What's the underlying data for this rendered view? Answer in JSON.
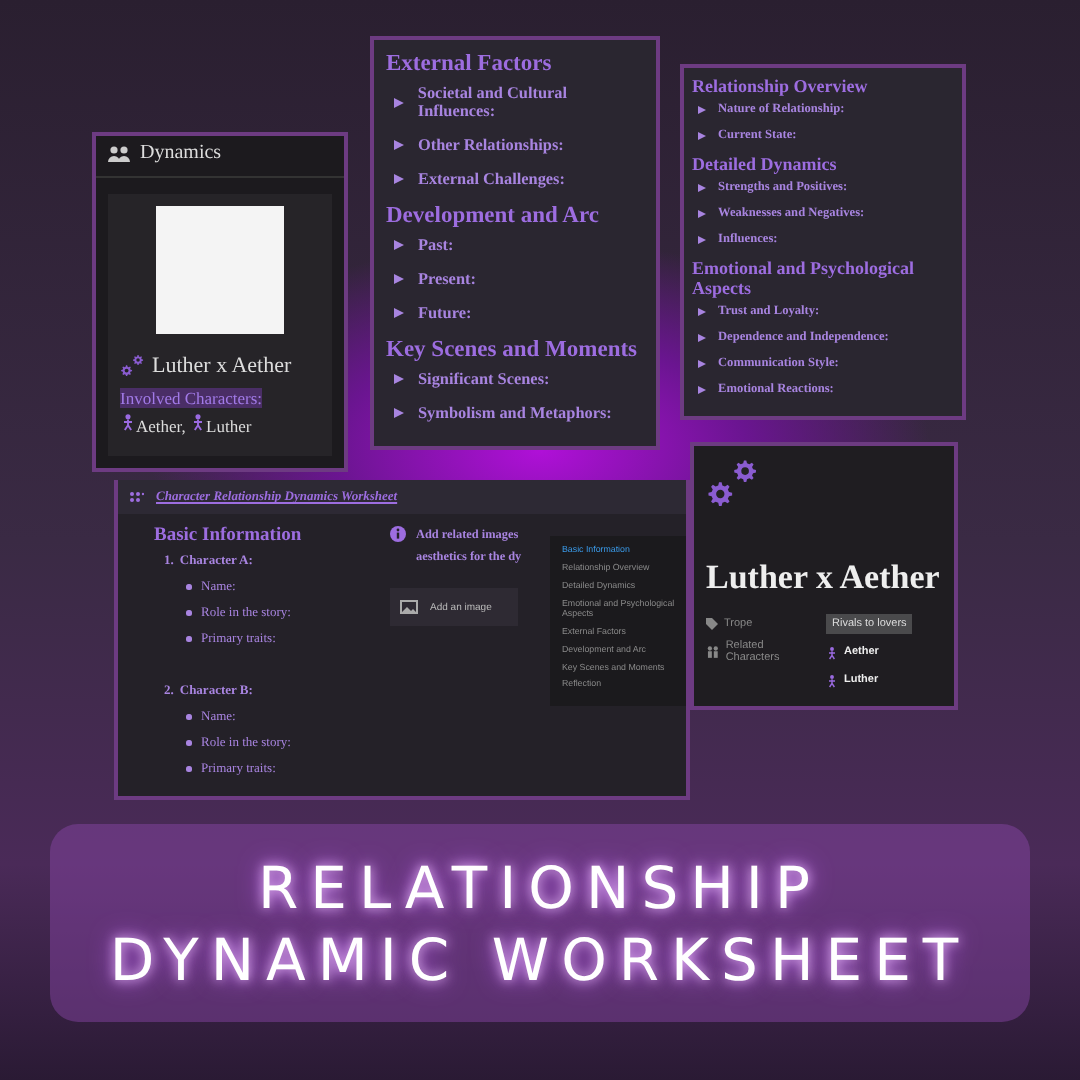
{
  "dynamics_card": {
    "title": "Dynamics",
    "page_title": "Luther x Aether",
    "property_label": "Involved Characters:",
    "characters": [
      "Aether,",
      "Luther"
    ]
  },
  "sections_card_1": {
    "sections": [
      {
        "heading": "External Factors",
        "items": [
          "Societal and Cultural Influences:",
          "Other Relationships:",
          "External Challenges:"
        ]
      },
      {
        "heading": "Development and Arc",
        "items": [
          "Past:",
          "Present:",
          "Future:"
        ]
      },
      {
        "heading": "Key Scenes and Moments",
        "items": [
          "Significant Scenes:",
          "Symbolism and Metaphors:"
        ]
      }
    ]
  },
  "sections_card_2": {
    "sections": [
      {
        "heading": "Relationship Overview",
        "items": [
          "Nature of Relationship:",
          "Current State:"
        ]
      },
      {
        "heading": "Detailed Dynamics",
        "items": [
          "Strengths and Positives:",
          "Weaknesses and Negatives:",
          "Influences:"
        ]
      },
      {
        "heading": "Emotional and Psychological Aspects",
        "items": [
          "Trust and Loyalty:",
          "Dependence and Independence:",
          "Communication Style:",
          "Emotional Reactions:"
        ]
      }
    ]
  },
  "worksheet_page": {
    "title": "Character Relationship Dynamics Worksheet",
    "heading": "Basic Information",
    "characters": [
      {
        "number": "1.",
        "label": "Character A:",
        "fields": [
          "Name:",
          "Role in the story:",
          "Primary traits:"
        ]
      },
      {
        "number": "2.",
        "label": "Character B:",
        "fields": [
          "Name:",
          "Role in the story:",
          "Primary traits:"
        ]
      }
    ],
    "callout": [
      "Add related images",
      "aesthetics for the dy"
    ],
    "image_button": "Add an image",
    "toc": [
      {
        "label": "Basic Information",
        "selected": true
      },
      {
        "label": "Relationship Overview",
        "selected": false
      },
      {
        "label": "Detailed Dynamics",
        "selected": false
      },
      {
        "label": "Emotional and Psychological Aspects",
        "selected": false
      },
      {
        "label": "External Factors",
        "selected": false
      },
      {
        "label": "Development and Arc",
        "selected": false
      },
      {
        "label": "Key Scenes and Moments",
        "selected": false
      },
      {
        "label": "Reflection",
        "selected": false
      }
    ]
  },
  "page_card": {
    "title": "Luther x Aether",
    "properties": [
      {
        "kind": "tag",
        "label": "Trope",
        "values": [
          "Rivals to lovers"
        ]
      },
      {
        "kind": "relation",
        "label": "Related Characters",
        "values": [
          "Aether",
          "Luther"
        ]
      }
    ]
  },
  "banner": {
    "lines": [
      "RELATIONSHIP",
      "DYNAMIC WORKSHEET"
    ]
  }
}
